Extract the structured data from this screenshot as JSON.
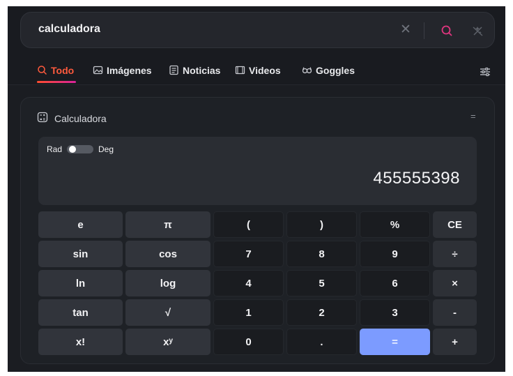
{
  "search": {
    "query": "calculadora"
  },
  "tabs": [
    {
      "label": "Todo",
      "icon": "search-icon",
      "active": true
    },
    {
      "label": "Imágenes",
      "icon": "image-icon"
    },
    {
      "label": "Noticias",
      "icon": "news-icon"
    },
    {
      "label": "Videos",
      "icon": "video-icon"
    },
    {
      "label": "Goggles",
      "icon": "goggles-icon"
    }
  ],
  "calculator": {
    "title": "Calculadora",
    "collapse_symbol": "=",
    "mode_left": "Rad",
    "mode_right": "Deg",
    "display_value": "455555398",
    "keys": [
      [
        "e",
        "π",
        "(",
        ")",
        "%",
        "CE"
      ],
      [
        "sin",
        "cos",
        "7",
        "8",
        "9",
        "÷"
      ],
      [
        "ln",
        "log",
        "4",
        "5",
        "6",
        "×"
      ],
      [
        "tan",
        "√",
        "1",
        "2",
        "3",
        "-"
      ],
      [
        "x!",
        "xʸ",
        "0",
        ".",
        "=",
        "+"
      ]
    ]
  },
  "colors": {
    "accent": "#ff5a3d",
    "equals": "#7c9bff"
  }
}
